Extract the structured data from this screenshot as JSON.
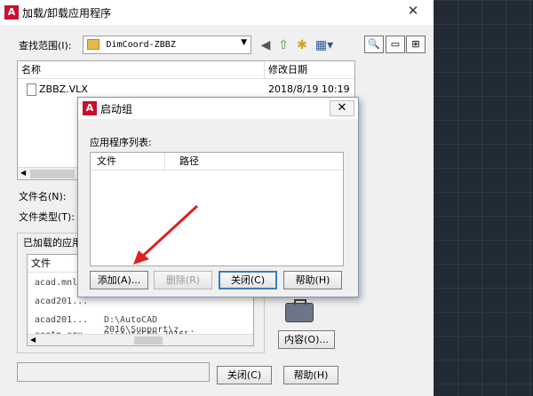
{
  "window": {
    "title": "加载/卸载应用程序",
    "close": "✕"
  },
  "lookin": {
    "label": "查找范围(I):",
    "value": "DimCoord-ZBBZ"
  },
  "file_list": {
    "col_name": "名称",
    "col_date": "修改日期",
    "rows": [
      {
        "name": "ZBBZ.VLX",
        "date": "2018/8/19 10:19"
      }
    ]
  },
  "filename_label": "文件名(N):",
  "filetype_label": "文件类型(T):",
  "loaded": {
    "label": "已加载的应用",
    "col_file": "文件",
    "rows": [
      {
        "name": "acad.mnl",
        "path": ""
      },
      {
        "name": "acad201...",
        "path": ""
      },
      {
        "name": "acad201...",
        "path": "D:\\AutoCAD 2016\\Support\\z..."
      },
      {
        "name": "acetp.arx",
        "path": "D:\\AutoCAD 2016\\"
      }
    ]
  },
  "contents_button": "内容(O)...",
  "footer": {
    "close": "关闭(C)",
    "help": "帮助(H)"
  },
  "startup": {
    "title": "启动组",
    "close": "✕",
    "list_label": "应用程序列表:",
    "col_file": "文件",
    "col_path": "路径",
    "buttons": {
      "add": "添加(A)...",
      "remove": "删除(R)",
      "close": "关闭(C)",
      "help": "帮助(H)"
    }
  },
  "colors": {
    "arrow": "#e02020",
    "accent": "#3b7cc4",
    "brand": "#c8102e"
  }
}
